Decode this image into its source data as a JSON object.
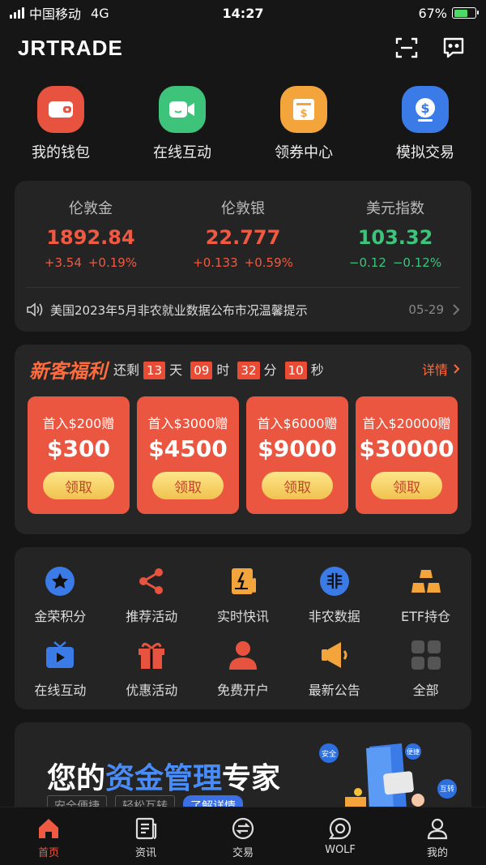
{
  "status": {
    "carrier": "中国移动",
    "network": "4G",
    "time": "14:27",
    "battery": "67%",
    "battery_level": 0.67
  },
  "header": {
    "title": "JRTRADE"
  },
  "quick_actions": [
    {
      "label": "我的钱包",
      "icon": "wallet-icon",
      "color": "#e8533f"
    },
    {
      "label": "在线互动",
      "icon": "video-chat-icon",
      "color": "#3ec47a"
    },
    {
      "label": "领券中心",
      "icon": "coupon-icon",
      "color": "#f3a43a"
    },
    {
      "label": "模拟交易",
      "icon": "dollar-icon",
      "color": "#3a7be8"
    }
  ],
  "market": [
    {
      "name": "伦敦金",
      "price": "1892.84",
      "change": "+3.54",
      "percent": "+0.19%",
      "trend": "up"
    },
    {
      "name": "伦敦银",
      "price": "22.777",
      "change": "+0.133",
      "percent": "+0.59%",
      "trend": "up"
    },
    {
      "name": "美元指数",
      "price": "103.32",
      "change": "−0.12",
      "percent": "−0.12%",
      "trend": "down"
    }
  ],
  "notice": {
    "text": "美国2023年5月非农就业数据公布市况温馨提示",
    "date": "05-29"
  },
  "welfare": {
    "title": "新客福利",
    "remaining_prefix": "还剩",
    "countdown": [
      {
        "value": "13",
        "unit": "天"
      },
      {
        "value": "09",
        "unit": "时"
      },
      {
        "value": "32",
        "unit": "分"
      },
      {
        "value": "10",
        "unit": "秒"
      }
    ],
    "detail_label": "详情",
    "coupons": [
      {
        "condition": "首入$200赠",
        "amount": "$300",
        "button": "领取"
      },
      {
        "condition": "首入$3000赠",
        "amount": "$4500",
        "button": "领取"
      },
      {
        "condition": "首入$6000赠",
        "amount": "$9000",
        "button": "领取"
      },
      {
        "condition": "首入$20000赠",
        "amount": "$30000",
        "button": "领取"
      }
    ]
  },
  "services": [
    {
      "label": "金荣积分",
      "icon": "points-icon"
    },
    {
      "label": "推荐活动",
      "icon": "share-icon"
    },
    {
      "label": "实时快讯",
      "icon": "flash-news-icon"
    },
    {
      "label": "非农数据",
      "icon": "nonfarm-data-icon"
    },
    {
      "label": "ETF持仓",
      "icon": "gold-bars-icon"
    },
    {
      "label": "在线互动",
      "icon": "tv-icon"
    },
    {
      "label": "优惠活动",
      "icon": "gift-icon"
    },
    {
      "label": "免费开户",
      "icon": "user-account-icon"
    },
    {
      "label": "最新公告",
      "icon": "megaphone-icon"
    },
    {
      "label": "全部",
      "icon": "all-grid-icon"
    }
  ],
  "banner": {
    "title_prefix": "您的",
    "title_highlight": "资金管理",
    "title_suffix": "专家",
    "tags": [
      "安全便捷",
      "轻松互转",
      "了解详情"
    ],
    "badges": [
      "安全",
      "便捷",
      "互转"
    ]
  },
  "tabs": [
    {
      "label": "首页",
      "icon": "home-icon",
      "active": true
    },
    {
      "label": "资讯",
      "icon": "news-icon",
      "active": false
    },
    {
      "label": "交易",
      "icon": "trade-icon",
      "active": false
    },
    {
      "label": "WOLF",
      "icon": "wolf-chat-icon",
      "active": false
    },
    {
      "label": "我的",
      "icon": "profile-icon",
      "active": false
    }
  ],
  "colors": {
    "accent": "#f05a42",
    "up": "#f05a42",
    "down": "#3cc47c",
    "highlight": "#4a8cf7"
  }
}
